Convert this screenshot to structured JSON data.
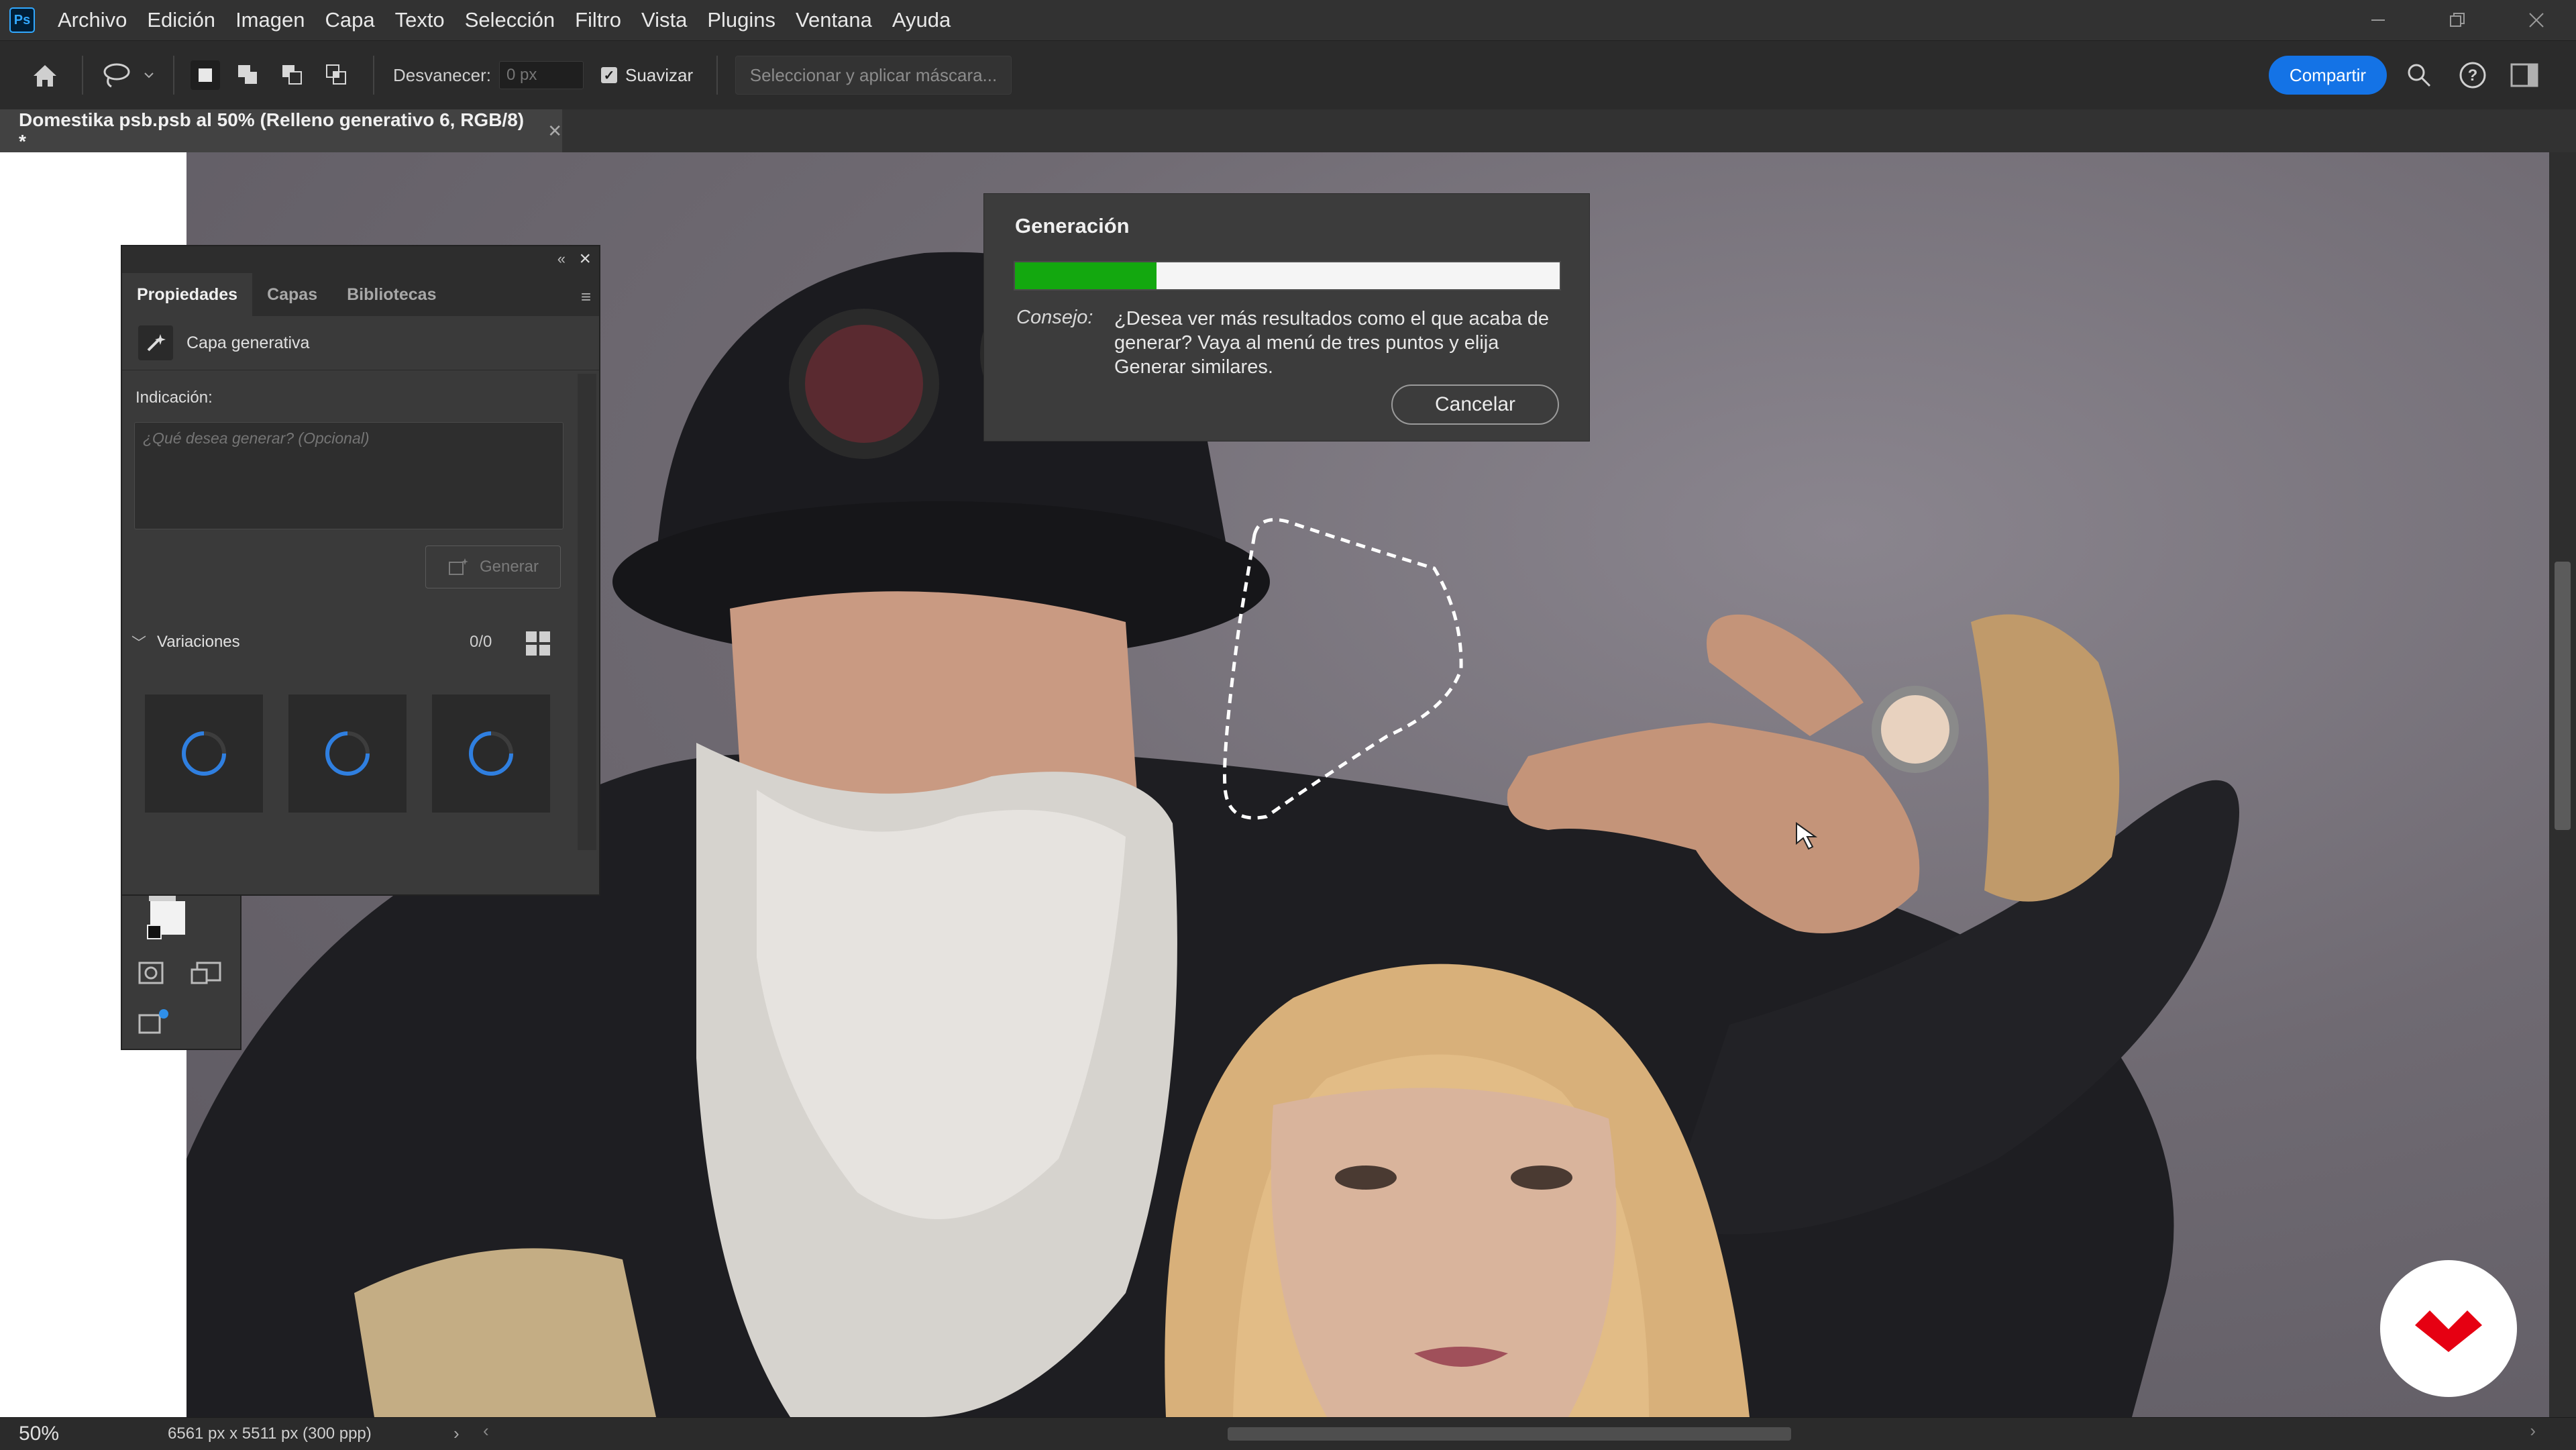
{
  "app": {
    "logo_text": "Ps"
  },
  "menu": [
    "Archivo",
    "Edición",
    "Imagen",
    "Capa",
    "Texto",
    "Selección",
    "Filtro",
    "Vista",
    "Plugins",
    "Ventana",
    "Ayuda"
  ],
  "options": {
    "fade_label": "Desvanecer:",
    "fade_placeholder": "0 px",
    "smooth_label": "Suavizar",
    "smooth_checked": true,
    "mask_button": "Seleccionar y aplicar máscara...",
    "share_button": "Compartir"
  },
  "document_tab": {
    "title": "Domestika psb.psb al 50% (Relleno generativo 6, RGB/8) *"
  },
  "properties_panel": {
    "tabs": [
      "Propiedades",
      "Capas",
      "Bibliotecas"
    ],
    "active_tab": "Propiedades",
    "layer_type": "Capa generativa",
    "prompt_label": "Indicación:",
    "prompt_placeholder": "¿Qué desea generar? (Opcional)",
    "generate_button": "Generar",
    "variations_label": "Variaciones",
    "variations_count": "0/0"
  },
  "generation_dialog": {
    "title": "Generación",
    "progress_percent": 26,
    "progress_color": "#13a80f",
    "tip_label": "Consejo:",
    "tip_text": "¿Desea ver más resultados como el que acaba de generar? Vaya al menú de tres puntos y elija Generar similares.",
    "cancel_button": "Cancelar"
  },
  "status": {
    "zoom": "50%",
    "doc_info": "6561 px x 5511 px (300 ppp)"
  },
  "colors": {
    "accent": "#1473e6",
    "watermark": "#e60012"
  }
}
